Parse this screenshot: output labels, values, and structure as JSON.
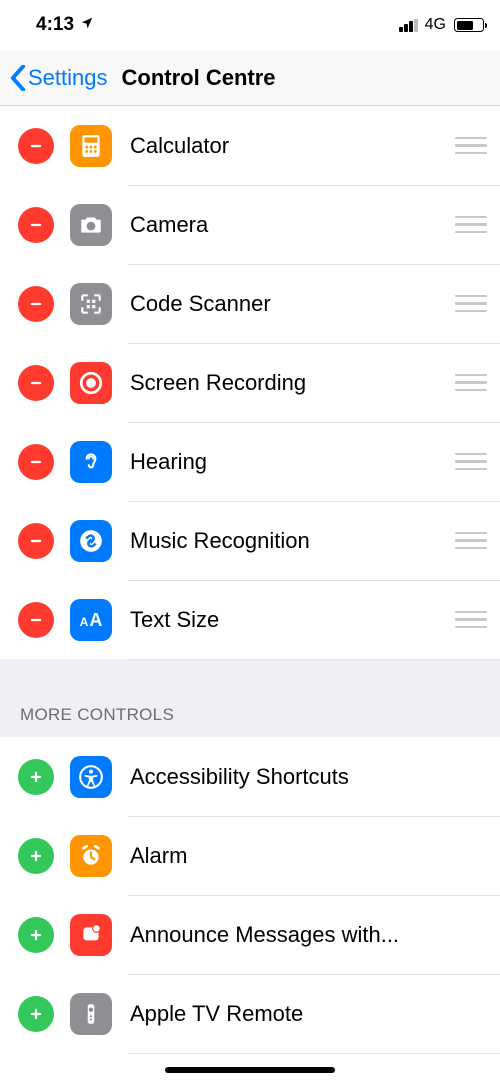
{
  "status": {
    "time": "4:13",
    "network": "4G"
  },
  "nav": {
    "back_label": "Settings",
    "title": "Control Centre"
  },
  "included": [
    {
      "label": "Calculator",
      "icon": "calculator-icon",
      "bg": "bg-orange"
    },
    {
      "label": "Camera",
      "icon": "camera-icon",
      "bg": "bg-grey"
    },
    {
      "label": "Code Scanner",
      "icon": "qr-scanner-icon",
      "bg": "bg-grey"
    },
    {
      "label": "Screen Recording",
      "icon": "record-icon",
      "bg": "bg-red"
    },
    {
      "label": "Hearing",
      "icon": "ear-icon",
      "bg": "bg-blue"
    },
    {
      "label": "Music Recognition",
      "icon": "shazam-icon",
      "bg": "bg-blue"
    },
    {
      "label": "Text Size",
      "icon": "text-size-icon",
      "bg": "bg-blue"
    }
  ],
  "more_header": "MORE CONTROLS",
  "more": [
    {
      "label": "Accessibility Shortcuts",
      "icon": "accessibility-icon",
      "bg": "bg-blue"
    },
    {
      "label": "Alarm",
      "icon": "alarm-icon",
      "bg": "bg-orange"
    },
    {
      "label": "Announce Messages with...",
      "icon": "announce-icon",
      "bg": "bg-red"
    },
    {
      "label": "Apple TV Remote",
      "icon": "tv-remote-icon",
      "bg": "bg-grey"
    }
  ]
}
